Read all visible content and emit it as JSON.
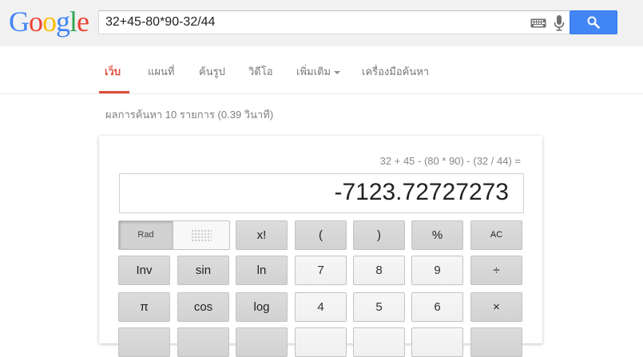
{
  "logo": {
    "letters": [
      "G",
      "o",
      "o",
      "g",
      "l",
      "e"
    ],
    "colors": [
      "#4285f4",
      "#ea4335",
      "#fbbc05",
      "#4285f4",
      "#34a853",
      "#ea4335"
    ]
  },
  "search": {
    "query": "32+45-80*90-32/44",
    "button_icon": "search-icon",
    "accent": "#4285f4"
  },
  "tabs": [
    {
      "label": "เว็บ",
      "active": true
    },
    {
      "label": "แผนที่",
      "active": false
    },
    {
      "label": "ค้นรูป",
      "active": false
    },
    {
      "label": "วิดีโอ",
      "active": false
    },
    {
      "label": "เพิ่มเติม",
      "active": false,
      "dropdown": true
    },
    {
      "label": "เครื่องมือค้นหา",
      "active": false
    }
  ],
  "result_stats": "ผลการค้นหา 10 รายการ (0.39 วินาที)",
  "calculator": {
    "expression": "32 + 45 - (80 * 90) - (32 / 44) =",
    "result": "-7123.72727273",
    "rad_label": "Rad",
    "rows": [
      [
        "x!",
        "(",
        ")",
        "%",
        "AC"
      ],
      [
        "Inv",
        "sin",
        "ln",
        "7",
        "8",
        "9",
        "÷"
      ],
      [
        "π",
        "cos",
        "log",
        "4",
        "5",
        "6",
        "×"
      ]
    ]
  }
}
